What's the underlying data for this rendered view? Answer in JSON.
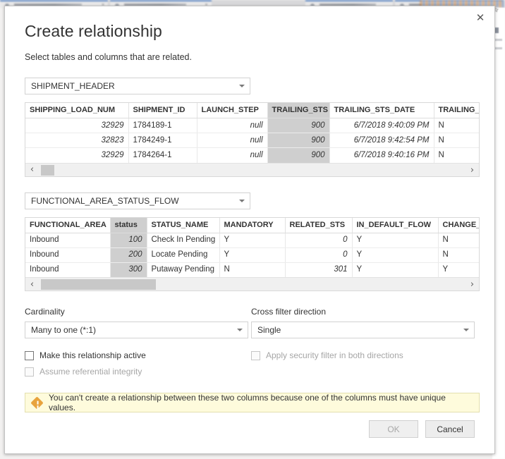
{
  "dialog": {
    "title": "Create relationship",
    "subtitle": "Select tables and columns that are related.",
    "close_label": "✕"
  },
  "table_one": {
    "dropdown_value": "SHIPMENT_HEADER",
    "selected_column": "TRAILING_STS",
    "columns": [
      "SHIPPING_LOAD_NUM",
      "SHIPMENT_ID",
      "LAUNCH_STEP",
      "TRAILING_STS",
      "TRAILING_STS_DATE",
      "TRAILING_STS_"
    ],
    "rows": [
      [
        "32929",
        "1784189-1",
        "null",
        "900",
        "6/7/2018 9:40:09 PM",
        "N"
      ],
      [
        "32823",
        "1784249-1",
        "null",
        "900",
        "6/7/2018 9:42:54 PM",
        "N"
      ],
      [
        "32929",
        "1784264-1",
        "null",
        "900",
        "6/7/2018 9:40:16 PM",
        "N"
      ]
    ],
    "scroll_left_label": "‹",
    "scroll_right_label": "›"
  },
  "table_two": {
    "dropdown_value": "FUNCTIONAL_AREA_STATUS_FLOW",
    "selected_column": "status",
    "columns": [
      "FUNCTIONAL_AREA",
      "status",
      "STATUS_NAME",
      "MANDATORY",
      "RELATED_STS",
      "IN_DEFAULT_FLOW",
      "CHANGE_/"
    ],
    "rows": [
      [
        "Inbound",
        "100",
        "Check In Pending",
        "Y",
        "0",
        "Y",
        "N"
      ],
      [
        "Inbound",
        "200",
        "Locate Pending",
        "Y",
        "0",
        "Y",
        "N"
      ],
      [
        "Inbound",
        "300",
        "Putaway Pending",
        "N",
        "301",
        "Y",
        "Y"
      ]
    ],
    "scroll_left_label": "‹",
    "scroll_right_label": "›"
  },
  "options": {
    "cardinality_label": "Cardinality",
    "cardinality_value": "Many to one (*:1)",
    "cross_filter_label": "Cross filter direction",
    "cross_filter_value": "Single"
  },
  "checkboxes": {
    "make_active": "Make this relationship active",
    "apply_security": "Apply security filter in both directions",
    "assume_integrity": "Assume referential integrity"
  },
  "warning": {
    "message": "You can't create a relationship between these two columns because one of the columns must have unique values."
  },
  "footer": {
    "ok_label": "OK",
    "cancel_label": "Cancel"
  },
  "colors": {
    "selected_column": "#cfcfcf",
    "warning_bg": "#fefbdc",
    "warning_border": "#e3dfae",
    "warning_icon": "#e8a33d"
  }
}
